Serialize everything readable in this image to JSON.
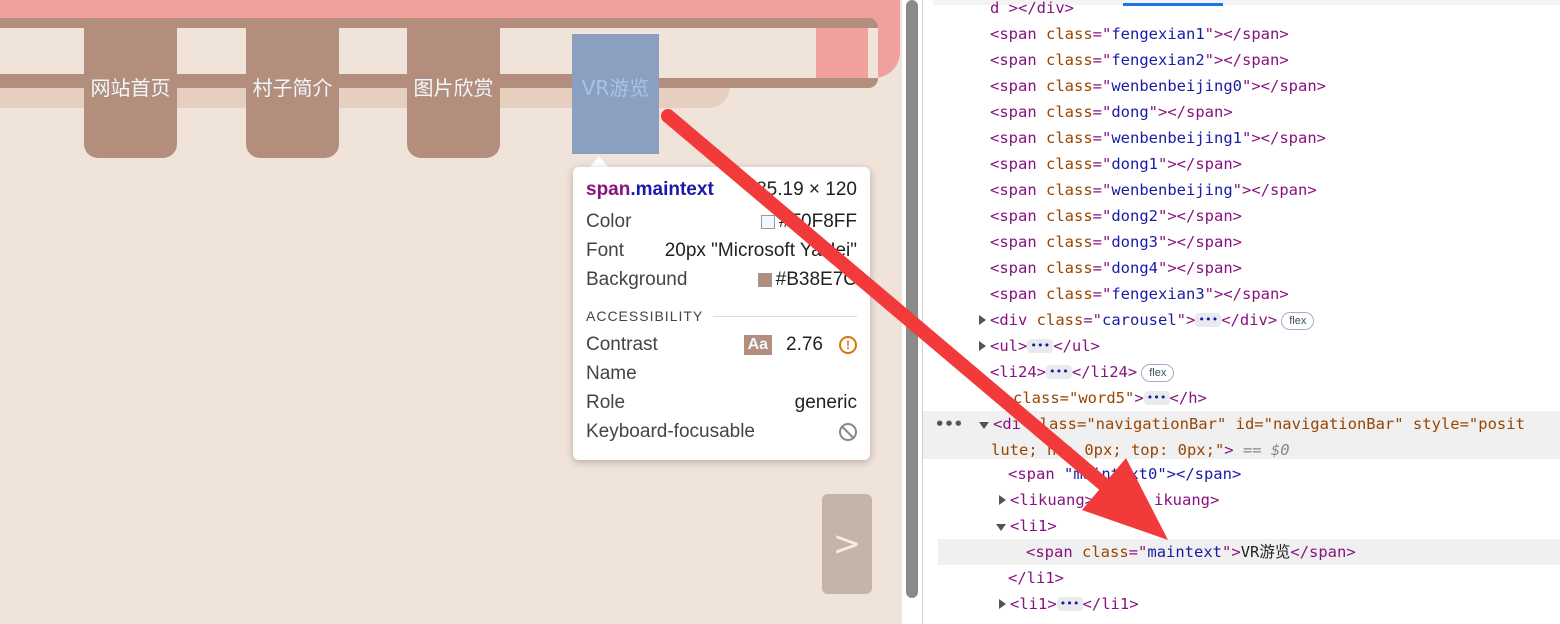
{
  "nav": {
    "items": [
      "网站首页",
      "村子简介",
      "图片欣赏"
    ],
    "active": "VR游览",
    "next_label": ">"
  },
  "tooltip": {
    "tag": "span",
    "cls": ".maintext",
    "size": "85.19 × 120",
    "color_label": "Color",
    "color_value": "#F0F8FF",
    "font_label": "Font",
    "font_value": "20px \"Microsoft YaHei\"",
    "bg_label": "Background",
    "bg_value": "#B38E7C",
    "section": "ACCESSIBILITY",
    "contrast_label": "Contrast",
    "contrast_aa": "Aa",
    "contrast_value": "2.76",
    "name_label": "Name",
    "role_label": "Role",
    "role_value": "generic",
    "focus_label": "Keyboard-focusable"
  },
  "devtools": {
    "top_fragment": "d ></div>",
    "spans": [
      "fengexian1",
      "fengexian2",
      "wenbenbeijing0",
      "dong",
      "wenbenbeijing1",
      "dong1",
      "wenbenbeijing",
      "dong2",
      "dong3",
      "dong4",
      "fengexian3"
    ],
    "carousel_class": "carousel",
    "flex_badge": "flex",
    "ul_tag": "ul",
    "li24_tag": "li24",
    "word5_fragment": "class=\"word5\"",
    "nav_line_a": "class=\"navigationBar\" id=\"navigationBar\" style=\"posit",
    "nav_line_b": "lute; ht: 0px; top: 0px;\"",
    "eq_zero": "== $0",
    "maintext0_fragment": "\"maintext0\"></span>",
    "likuang_fragment": "ikuang>",
    "li1": "li1",
    "maintext_text": "VR游览",
    "span_tag": "span",
    "class_attr": "class"
  }
}
